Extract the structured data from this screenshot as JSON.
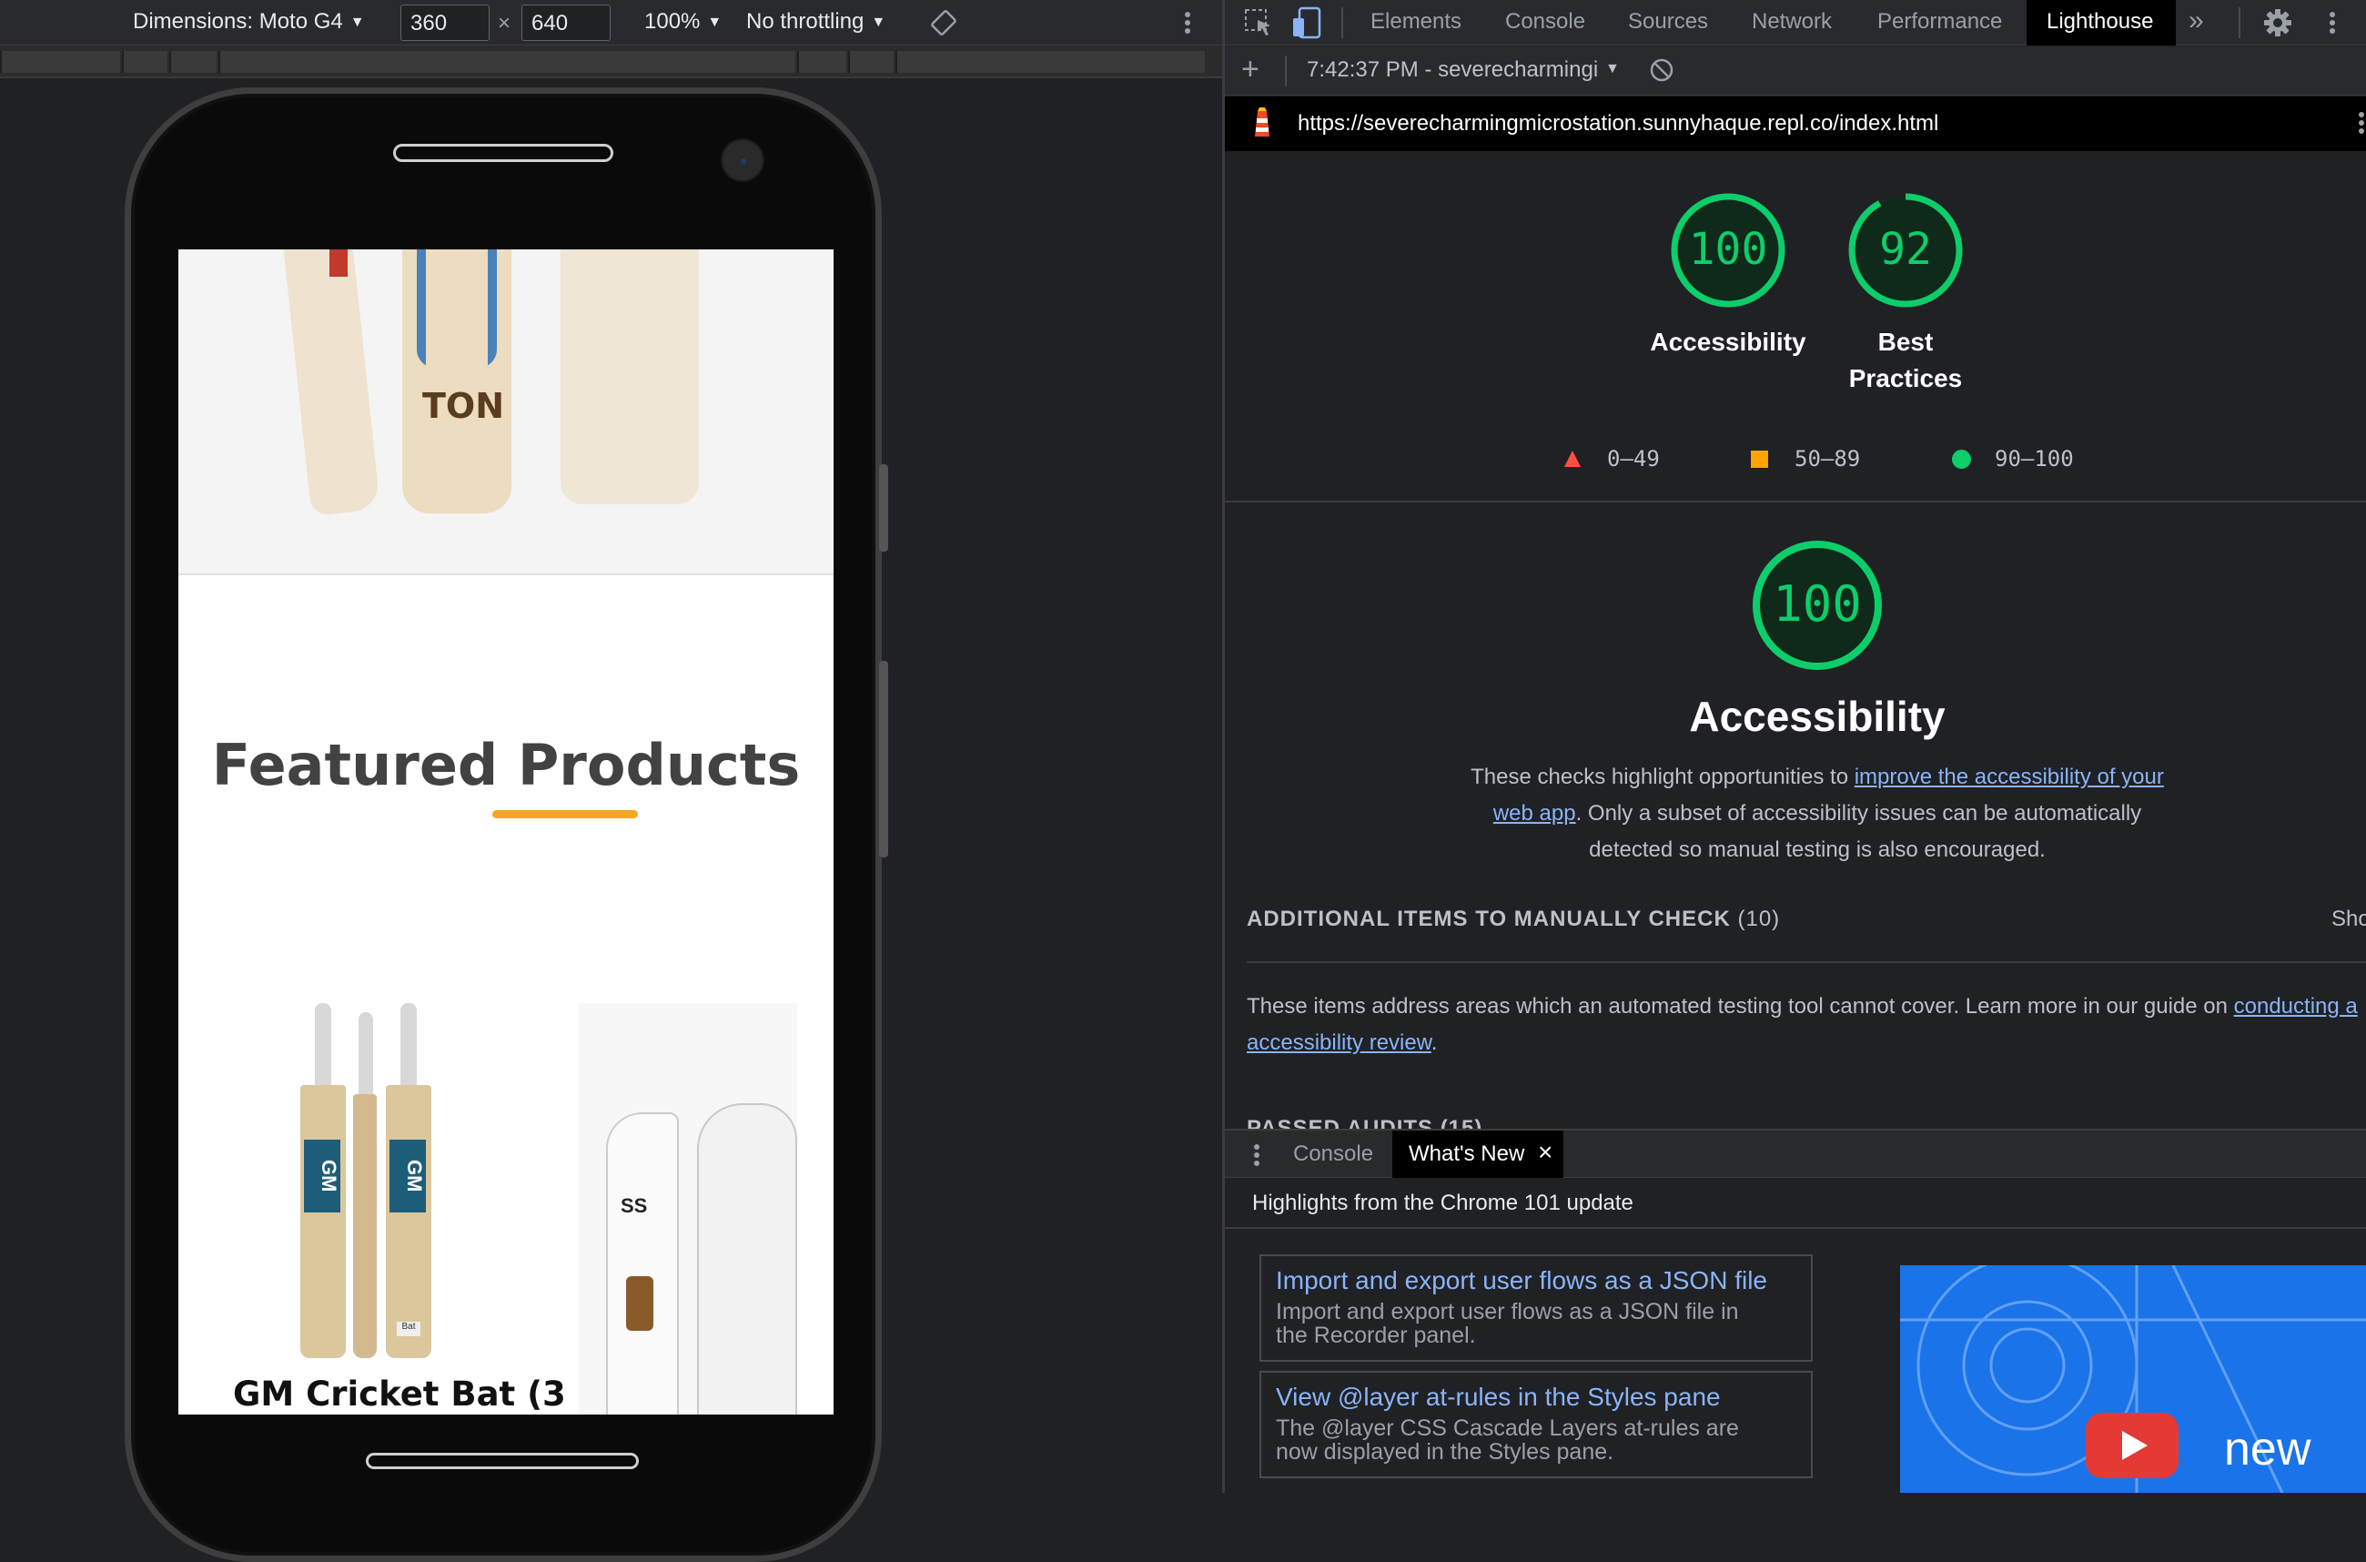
{
  "device_toolbar": {
    "dimensions_label": "Dimensions: Moto G4",
    "width_value": "360",
    "times": "×",
    "height_value": "640",
    "zoom": "100%",
    "throttling": "No throttling"
  },
  "page": {
    "hero_logo_text": "TON",
    "featured_title": "Featured Products",
    "product_name": "GM Cricket Bat (3",
    "bat_logo": "GM",
    "pad_logo": "SS",
    "bat_badge": "Bat"
  },
  "devtools": {
    "tabs": [
      "Elements",
      "Console",
      "Sources",
      "Network",
      "Performance",
      "Lighthouse"
    ],
    "more_tabs": "»",
    "lighthouse_bar": {
      "add": "+",
      "report_label": "7:42:37 PM - severecharmingi"
    },
    "url": "https://severecharmingmicrostation.sunnyhaque.repl.co/index.html",
    "scores": [
      {
        "value": "100",
        "label": "Accessibility",
        "score": 100
      },
      {
        "value": "92",
        "label": "Best Practices",
        "score": 92
      }
    ],
    "best_practices_line1": "Best",
    "best_practices_line2": "Practices",
    "legend": [
      {
        "range": "0–49",
        "color": "#ff4e42"
      },
      {
        "range": "50–89",
        "color": "#ffa400"
      },
      {
        "range": "90–100",
        "color": "#0cce6b"
      }
    ],
    "category": {
      "score": "100",
      "title": "Accessibility",
      "desc_before": "These checks highlight opportunities to ",
      "desc_link_1": "improve the accessibility of your",
      "desc_link_2": "web app",
      "desc_line2_after": ". Only a subset of accessibility issues can be automatically",
      "desc_line3": "detected so manual testing is also encouraged."
    },
    "manual_check": {
      "heading": "ADDITIONAL ITEMS TO MANUALLY CHECK",
      "count": "(10)",
      "show": "Sho",
      "desc": "These items address areas which an automated testing tool cannot cover. Learn more in our guide on ",
      "link_1": "conducting a",
      "link_2": "accessibility review",
      "period": "."
    },
    "passed_audits": "PASSED AUDITS (15)",
    "drawer": {
      "tabs": [
        "Console",
        "What's New"
      ],
      "close": "×",
      "highlights": "Highlights from the Chrome 101 update",
      "cards": [
        {
          "title": "Import and export user flows as a JSON file",
          "desc_1": "Import and export user flows as a JSON file in",
          "desc_2": "the Recorder panel."
        },
        {
          "title": "View @layer at-rules in the Styles pane",
          "desc_1": "The @layer CSS Cascade Layers at-rules are",
          "desc_2": "now displayed in the Styles pane."
        }
      ],
      "video_text": "new"
    }
  },
  "colors": {
    "pass_green": "#0cce6b",
    "accent_orange": "#f5a623",
    "link_blue": "#8ab4f8"
  }
}
